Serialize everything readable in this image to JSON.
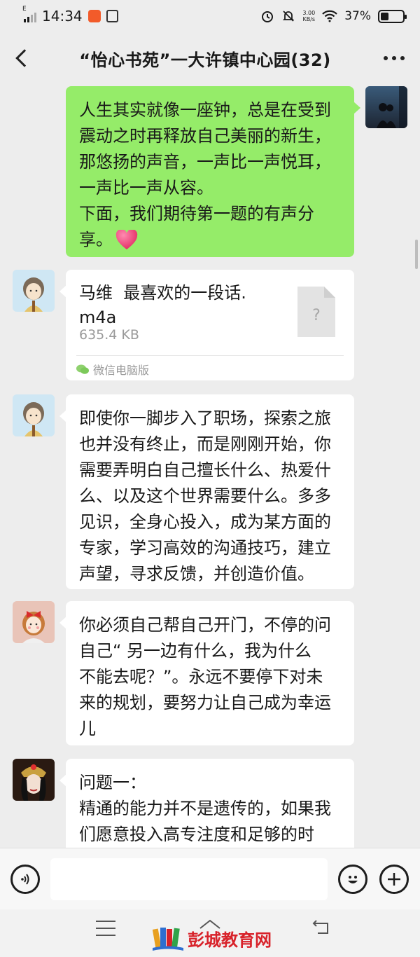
{
  "status_bar": {
    "time": "14:34",
    "network_type": "E",
    "net_speed_value": "3.00",
    "net_speed_unit": "KB/s",
    "battery_percent": "37%",
    "battery_level": 0.37
  },
  "header": {
    "title": "“怡心书苑”一大许镇中心园(32)"
  },
  "messages": [
    {
      "kind": "text",
      "side": "right",
      "text": "人生其实就像一座钟，总是在受到\n震动之时再释放自己美丽的新生，\n那悠扬的声音，一声比一声悦耳，\n一声比一声从容。\n下面，我们期待第一题的有声分\n享。",
      "emoji": "heart"
    },
    {
      "kind": "file",
      "side": "left",
      "file_name": "马维  最喜欢的一段话.\nm4a",
      "file_size": "635.4 KB",
      "source": "微信电脑版"
    },
    {
      "kind": "text",
      "side": "left",
      "text": "即使你一脚步入了职场，探索之旅\n也并没有终止，而是刚刚开始，你\n需要弄明白自己擅长什么、热爱什\n么、以及这个世界需要什么。多多\n见识，全身心投入，成为某方面的\n专家，学习高效的沟通技巧，建立\n声望，寻求反馈，并创造价值。"
    },
    {
      "kind": "text",
      "side": "left",
      "text": "你必须自己帮自己开门，不停的问\n自己“ 另一边有什么，我为什么\n不能去呢？”。永远不要停下对未\n来的规划，要努力让自己成为幸运\n儿"
    },
    {
      "kind": "text",
      "side": "left",
      "text": "问题一：\n精通的能力并不是遗传的，如果我\n们愿意投入高专注度和足够的时"
    }
  ],
  "input_bar": {
    "voice_icon": "voice-icon",
    "emoji_icon": "emoji-icon",
    "plus_icon": "plus-icon"
  },
  "watermark": {
    "text": "彭城教育网"
  },
  "colors": {
    "background": "#ededed",
    "self_bubble": "#95ec69",
    "other_bubble": "#ffffff",
    "watermark": "#d8222a"
  }
}
